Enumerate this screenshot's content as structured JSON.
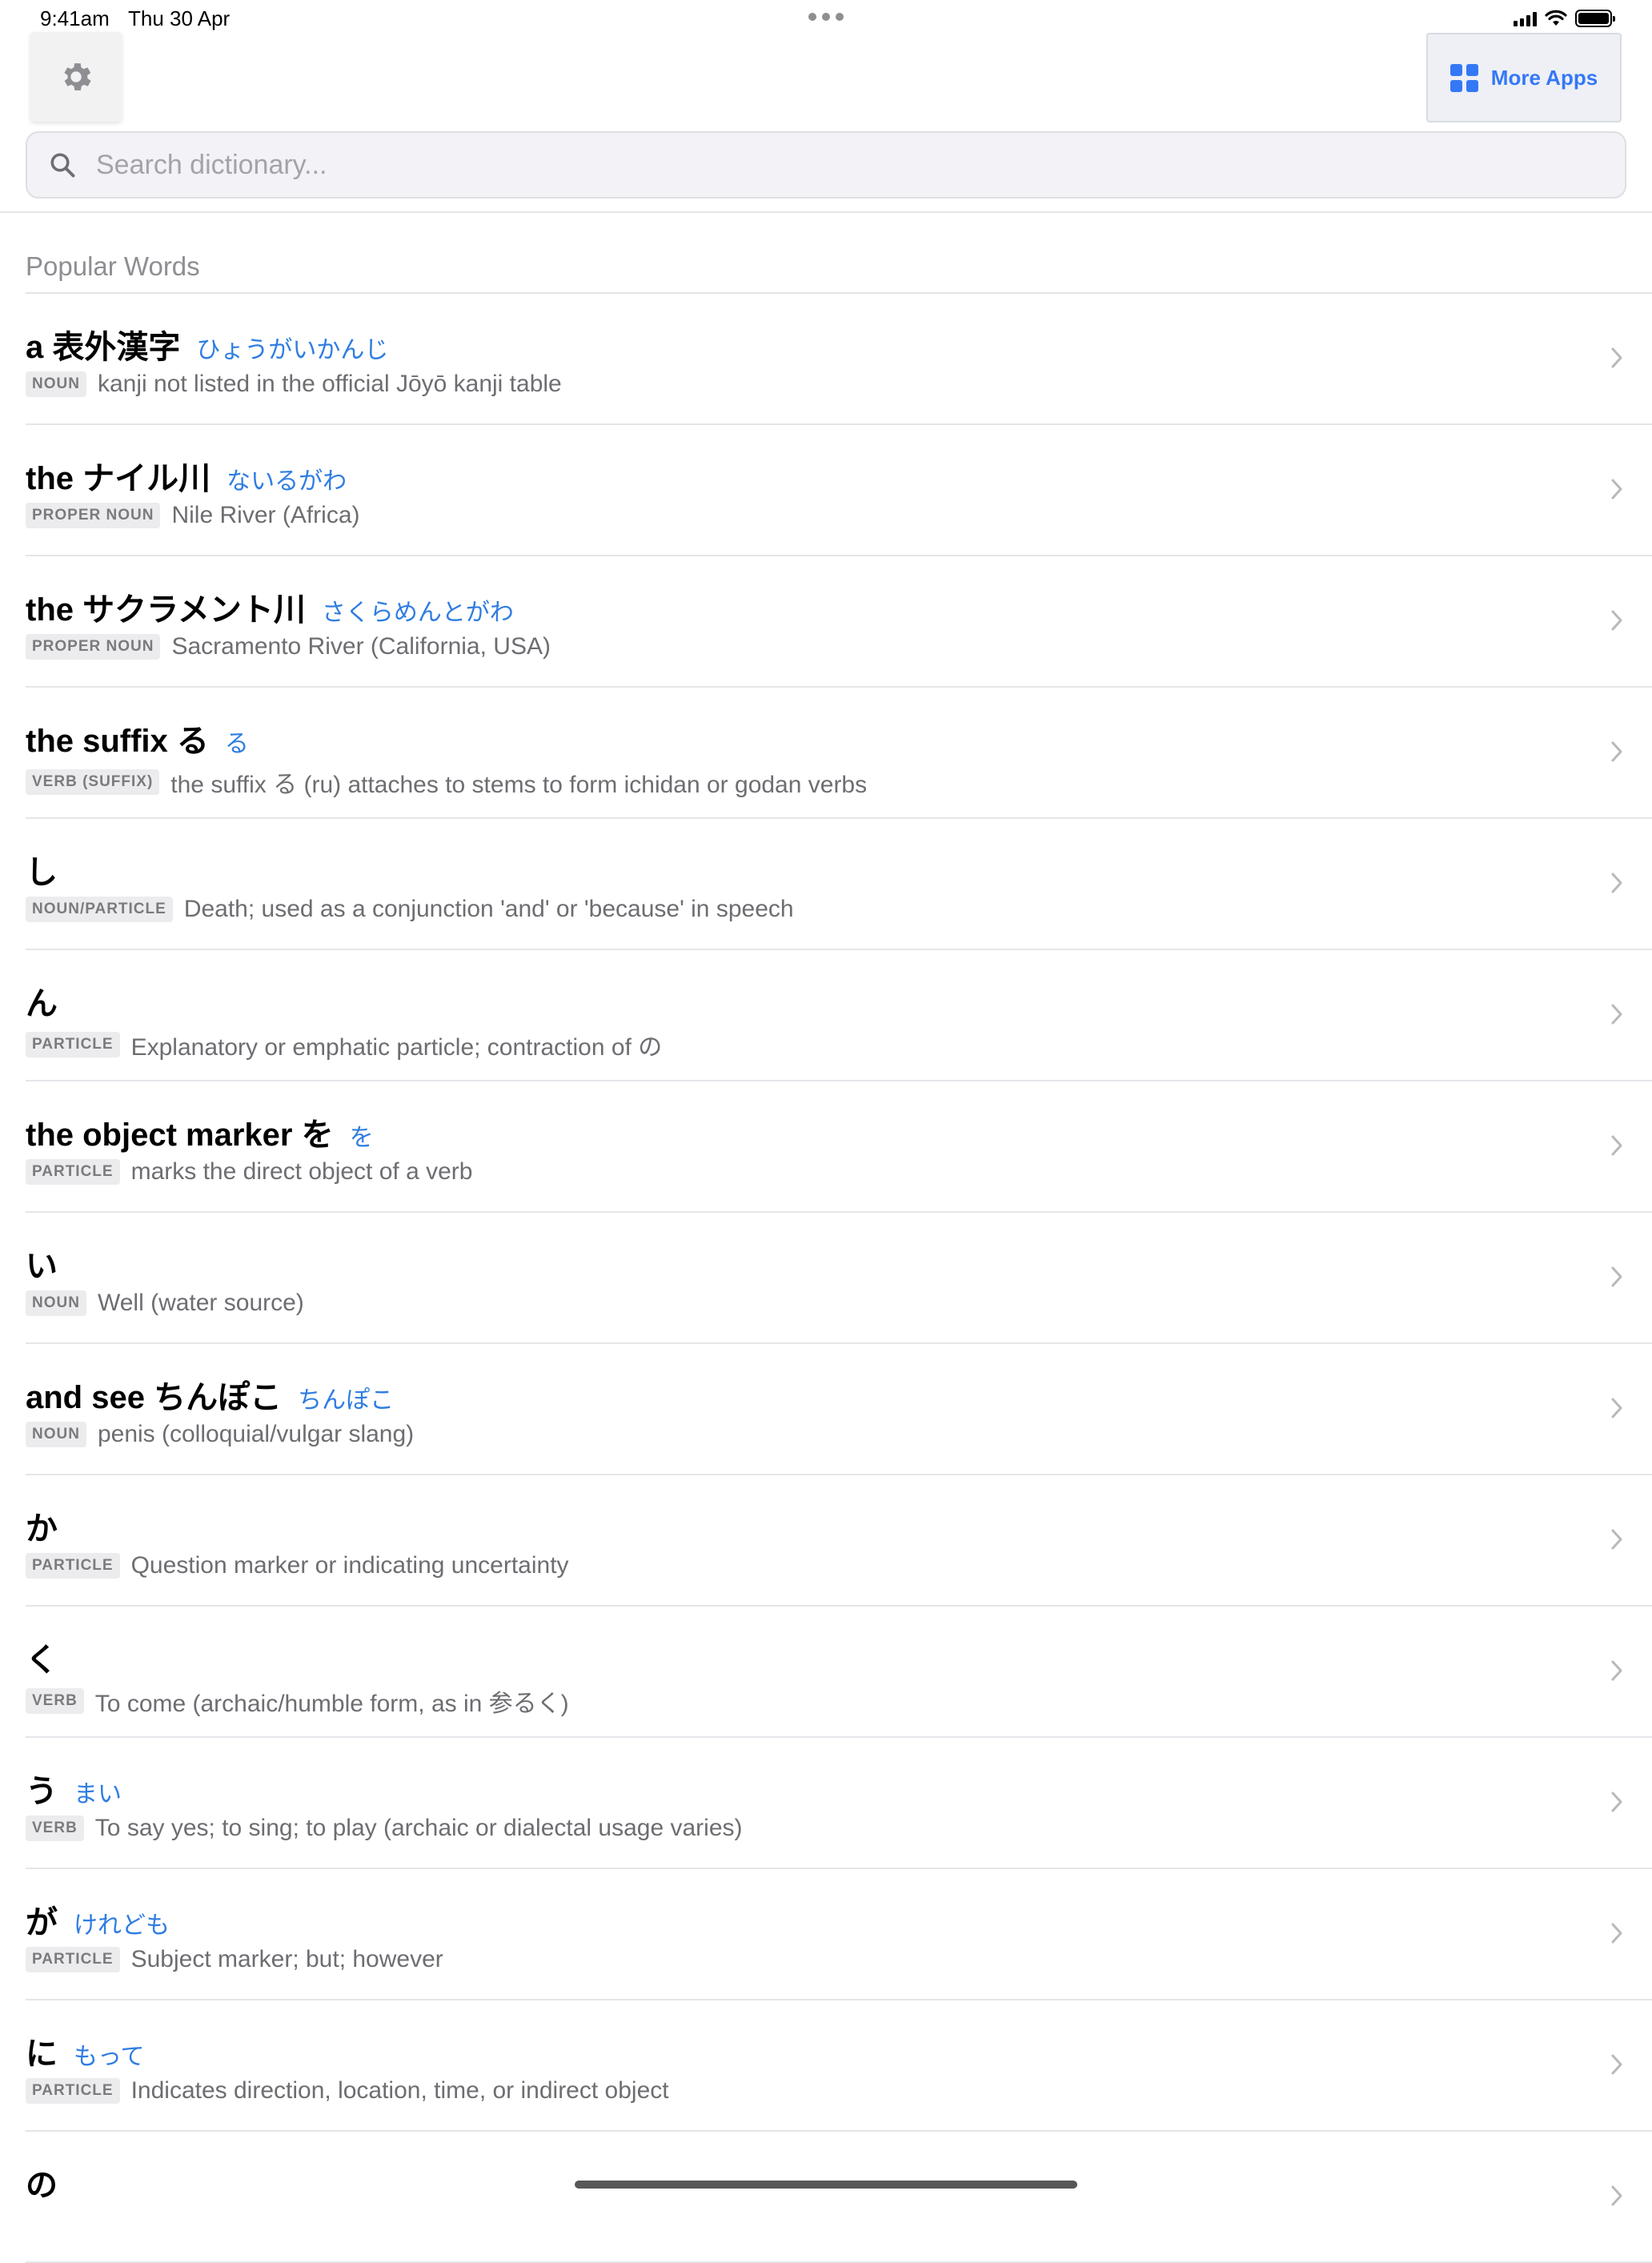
{
  "status_bar": {
    "time": "9:41am",
    "date": "Thu 30 Apr"
  },
  "header": {
    "more_apps_label": "More Apps"
  },
  "search": {
    "placeholder": "Search dictionary..."
  },
  "section": {
    "title": "Popular Words"
  },
  "entries": [
    {
      "term": "a 表外漢字",
      "reading": "ひょうがいかんじ",
      "pos": "NOUN",
      "definition": "kanji not listed in the official Jōyō kanji table"
    },
    {
      "term": "the ナイル川",
      "reading": "ないるがわ",
      "pos": "PROPER NOUN",
      "definition": "Nile River (Africa)"
    },
    {
      "term": "the サクラメント川",
      "reading": "さくらめんとがわ",
      "pos": "PROPER NOUN",
      "definition": "Sacramento River (California, USA)"
    },
    {
      "term": "the suffix る",
      "reading": "る",
      "pos": "VERB (SUFFIX)",
      "definition": "the suffix る (ru) attaches to stems to form ichidan or godan verbs"
    },
    {
      "term": "し",
      "reading": "",
      "pos": "NOUN/PARTICLE",
      "definition": "Death; used as a conjunction 'and' or 'because' in speech"
    },
    {
      "term": "ん",
      "reading": "",
      "pos": "PARTICLE",
      "definition": "Explanatory or emphatic particle; contraction of の"
    },
    {
      "term": "the object marker を",
      "reading": "を",
      "pos": "PARTICLE",
      "definition": "marks the direct object of a verb"
    },
    {
      "term": "い",
      "reading": "",
      "pos": "NOUN",
      "definition": "Well (water source)"
    },
    {
      "term": "and see ちんぽこ",
      "reading": "ちんぽこ",
      "pos": "NOUN",
      "definition": "penis (colloquial/vulgar slang)"
    },
    {
      "term": "か",
      "reading": "",
      "pos": "PARTICLE",
      "definition": "Question marker or indicating uncertainty"
    },
    {
      "term": "く",
      "reading": "",
      "pos": "VERB",
      "definition": "To come (archaic/humble form, as in 参るく)"
    },
    {
      "term": "う",
      "reading": "まい",
      "pos": "VERB",
      "definition": "To say yes; to sing; to play (archaic or dialectal usage varies)"
    },
    {
      "term": "が",
      "reading": "けれども",
      "pos": "PARTICLE",
      "definition": "Subject marker; but; however"
    },
    {
      "term": "に",
      "reading": "もって",
      "pos": "PARTICLE",
      "definition": "Indicates direction, location, time, or indirect object"
    },
    {
      "term": "の",
      "reading": "",
      "pos": "",
      "definition": ""
    }
  ],
  "colors": {
    "accent": "#3478f6",
    "reading": "#2f7de1",
    "secondary_text": "#6d6d72"
  },
  "icons": {
    "settings": "gear-icon",
    "more_apps": "grid-icon",
    "search": "search-icon",
    "row_action": "chevron-right-icon"
  }
}
